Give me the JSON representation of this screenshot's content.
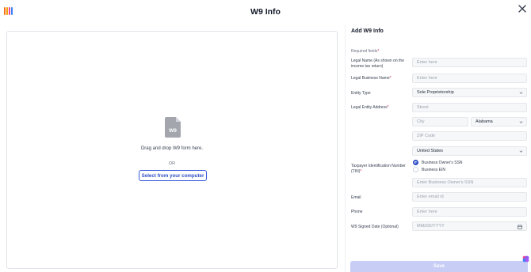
{
  "page": {
    "title": "W9 Info"
  },
  "brand": {
    "colors": [
      "#f97316",
      "#f59e0b",
      "#ec4899",
      "#3b82f6"
    ]
  },
  "dropzone": {
    "file_label": "W9",
    "drop_text": "Drag and drop W9 form here.",
    "or_text": "OR",
    "select_button": "Select from your computer"
  },
  "panel": {
    "title": "Add W9 Info",
    "required_note": "Required fields",
    "legal_name": {
      "label": "Legal Name (As shown on the income tax return)",
      "placeholder": "Enter here"
    },
    "business_name": {
      "label": "Legal Business Name",
      "placeholder": "Enter here"
    },
    "entity_type": {
      "label": "Entity Type",
      "value": "Sole Proprietorship"
    },
    "address": {
      "label": "Legal Entity Address",
      "street": "Street",
      "city": "City",
      "state": "Alabama",
      "zip": "ZIP Code",
      "country": "United States"
    },
    "tin": {
      "label": "Taxpayer Identification Number (TIN)",
      "options": [
        "Business Owner's SSN",
        "Business EIN"
      ],
      "selected": "Business Owner's SSN",
      "placeholder": "Enter Business Owner's SSN"
    },
    "email": {
      "label": "Email",
      "placeholder": "Enter email id"
    },
    "phone": {
      "label": "Phone",
      "placeholder": "Enter here"
    },
    "signed_date": {
      "label": "W9 Signed Date (Optional)",
      "placeholder": "MM/DD/YYYY"
    },
    "save": "Save"
  },
  "icons": [
    "close-icon",
    "file-icon",
    "chevron-down-icon",
    "calendar-icon",
    "chat-icon",
    "logo-icon"
  ],
  "colors": {
    "accent": "#2f4fc7",
    "save_disabled": "#c7cdf5",
    "required": "#e11d48"
  }
}
